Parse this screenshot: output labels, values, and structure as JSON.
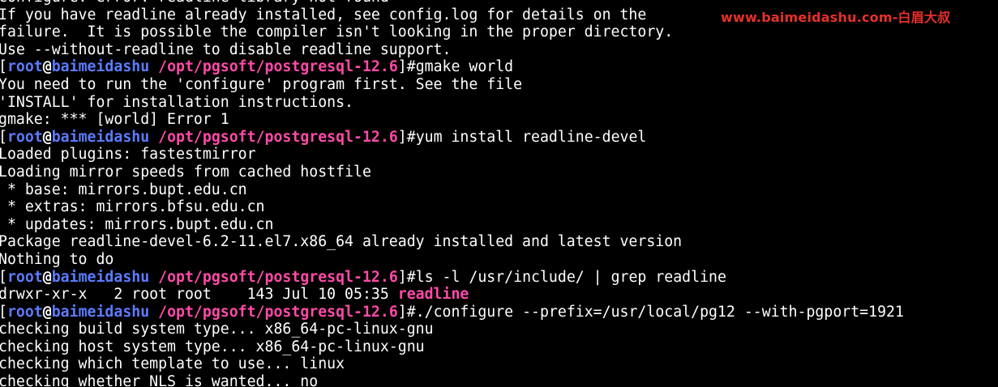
{
  "prompt": {
    "user": "root",
    "at": "@",
    "host": "baimeidashu",
    "path": "/opt/pgsoft/postgresql-12.6",
    "open": "[",
    "close": "]#"
  },
  "watermark": "www.baimeidashu.com-白眉大叔",
  "lines": [
    {
      "kind": "out",
      "text": "configure: error: readline library not found"
    },
    {
      "kind": "out",
      "text": "If you have readline already installed, see config.log for details on the"
    },
    {
      "kind": "out",
      "text": "failure.  It is possible the compiler isn't looking in the proper directory."
    },
    {
      "kind": "out",
      "text": "Use --without-readline to disable readline support."
    },
    {
      "kind": "cmd",
      "text": "gmake world"
    },
    {
      "kind": "out",
      "text": "You need to run the 'configure' program first. See the file"
    },
    {
      "kind": "out",
      "text": "'INSTALL' for installation instructions."
    },
    {
      "kind": "out",
      "text": "gmake: *** [world] Error 1"
    },
    {
      "kind": "cmd",
      "text": "yum install readline-devel"
    },
    {
      "kind": "out",
      "text": "Loaded plugins: fastestmirror"
    },
    {
      "kind": "out",
      "text": "Loading mirror speeds from cached hostfile"
    },
    {
      "kind": "out",
      "text": " * base: mirrors.bupt.edu.cn"
    },
    {
      "kind": "out",
      "text": " * extras: mirrors.bfsu.edu.cn"
    },
    {
      "kind": "out",
      "text": " * updates: mirrors.bupt.edu.cn"
    },
    {
      "kind": "out",
      "text": "Package readline-devel-6.2-11.el7.x86_64 already installed and latest version"
    },
    {
      "kind": "out",
      "text": "Nothing to do"
    },
    {
      "kind": "cmd",
      "text": "ls -l /usr/include/ | grep readline"
    },
    {
      "kind": "ls",
      "text": "drwxr-xr-x   2 root root    143 Jul 10 05:35 ",
      "highlight": "readline"
    },
    {
      "kind": "cmd",
      "text": "./configure --prefix=/usr/local/pg12 --with-pgport=1921"
    },
    {
      "kind": "out",
      "text": "checking build system type... x86_64-pc-linux-gnu"
    },
    {
      "kind": "out",
      "text": "checking host system type... x86_64-pc-linux-gnu"
    },
    {
      "kind": "out",
      "text": "checking which template to use... linux"
    },
    {
      "kind": "out",
      "text": "checking whether NLS is wanted... no"
    }
  ]
}
